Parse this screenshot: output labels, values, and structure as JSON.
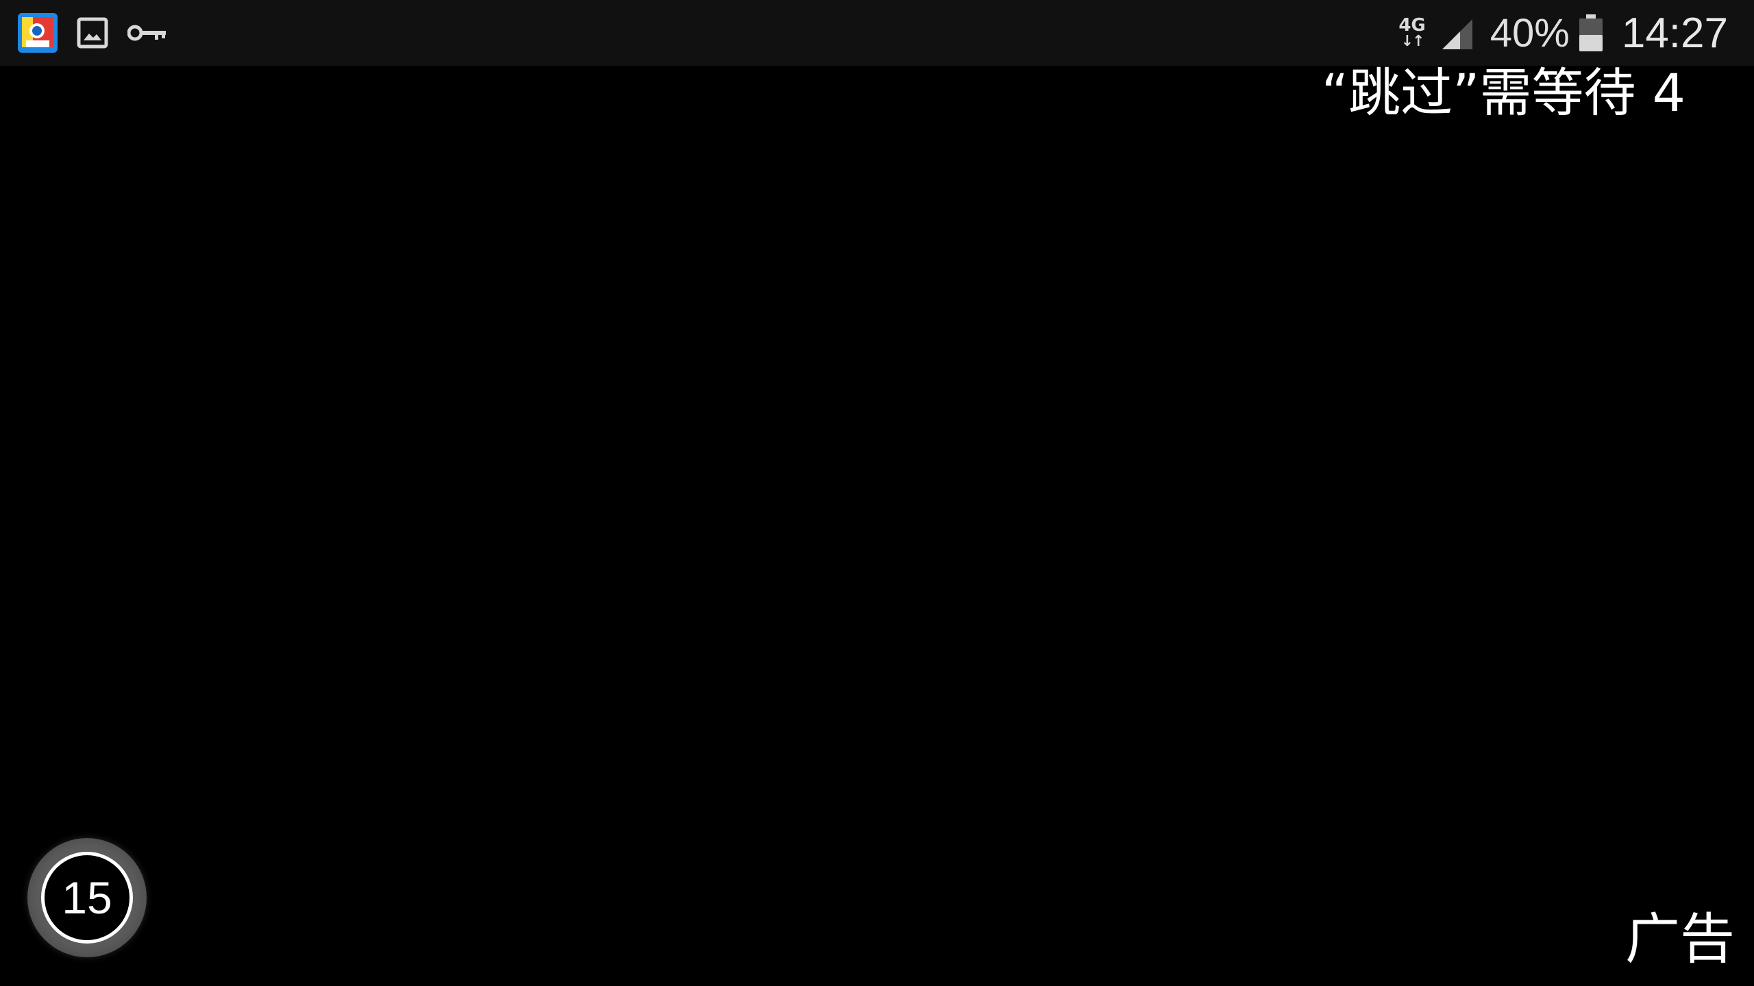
{
  "status_bar": {
    "left_icons": [
      "app-notification-icon",
      "gallery-icon",
      "key-icon"
    ],
    "network_type": "4G",
    "network_arrows": "↓↑",
    "battery_percent": "40%",
    "time": "14:27"
  },
  "ad": {
    "skip_wait_text": "“跳过”需等待 4",
    "countdown_seconds": "15",
    "ad_label": "广告"
  },
  "colors": {
    "background": "#000000",
    "status_bar_bg": "#111111",
    "text": "#ffffff"
  }
}
